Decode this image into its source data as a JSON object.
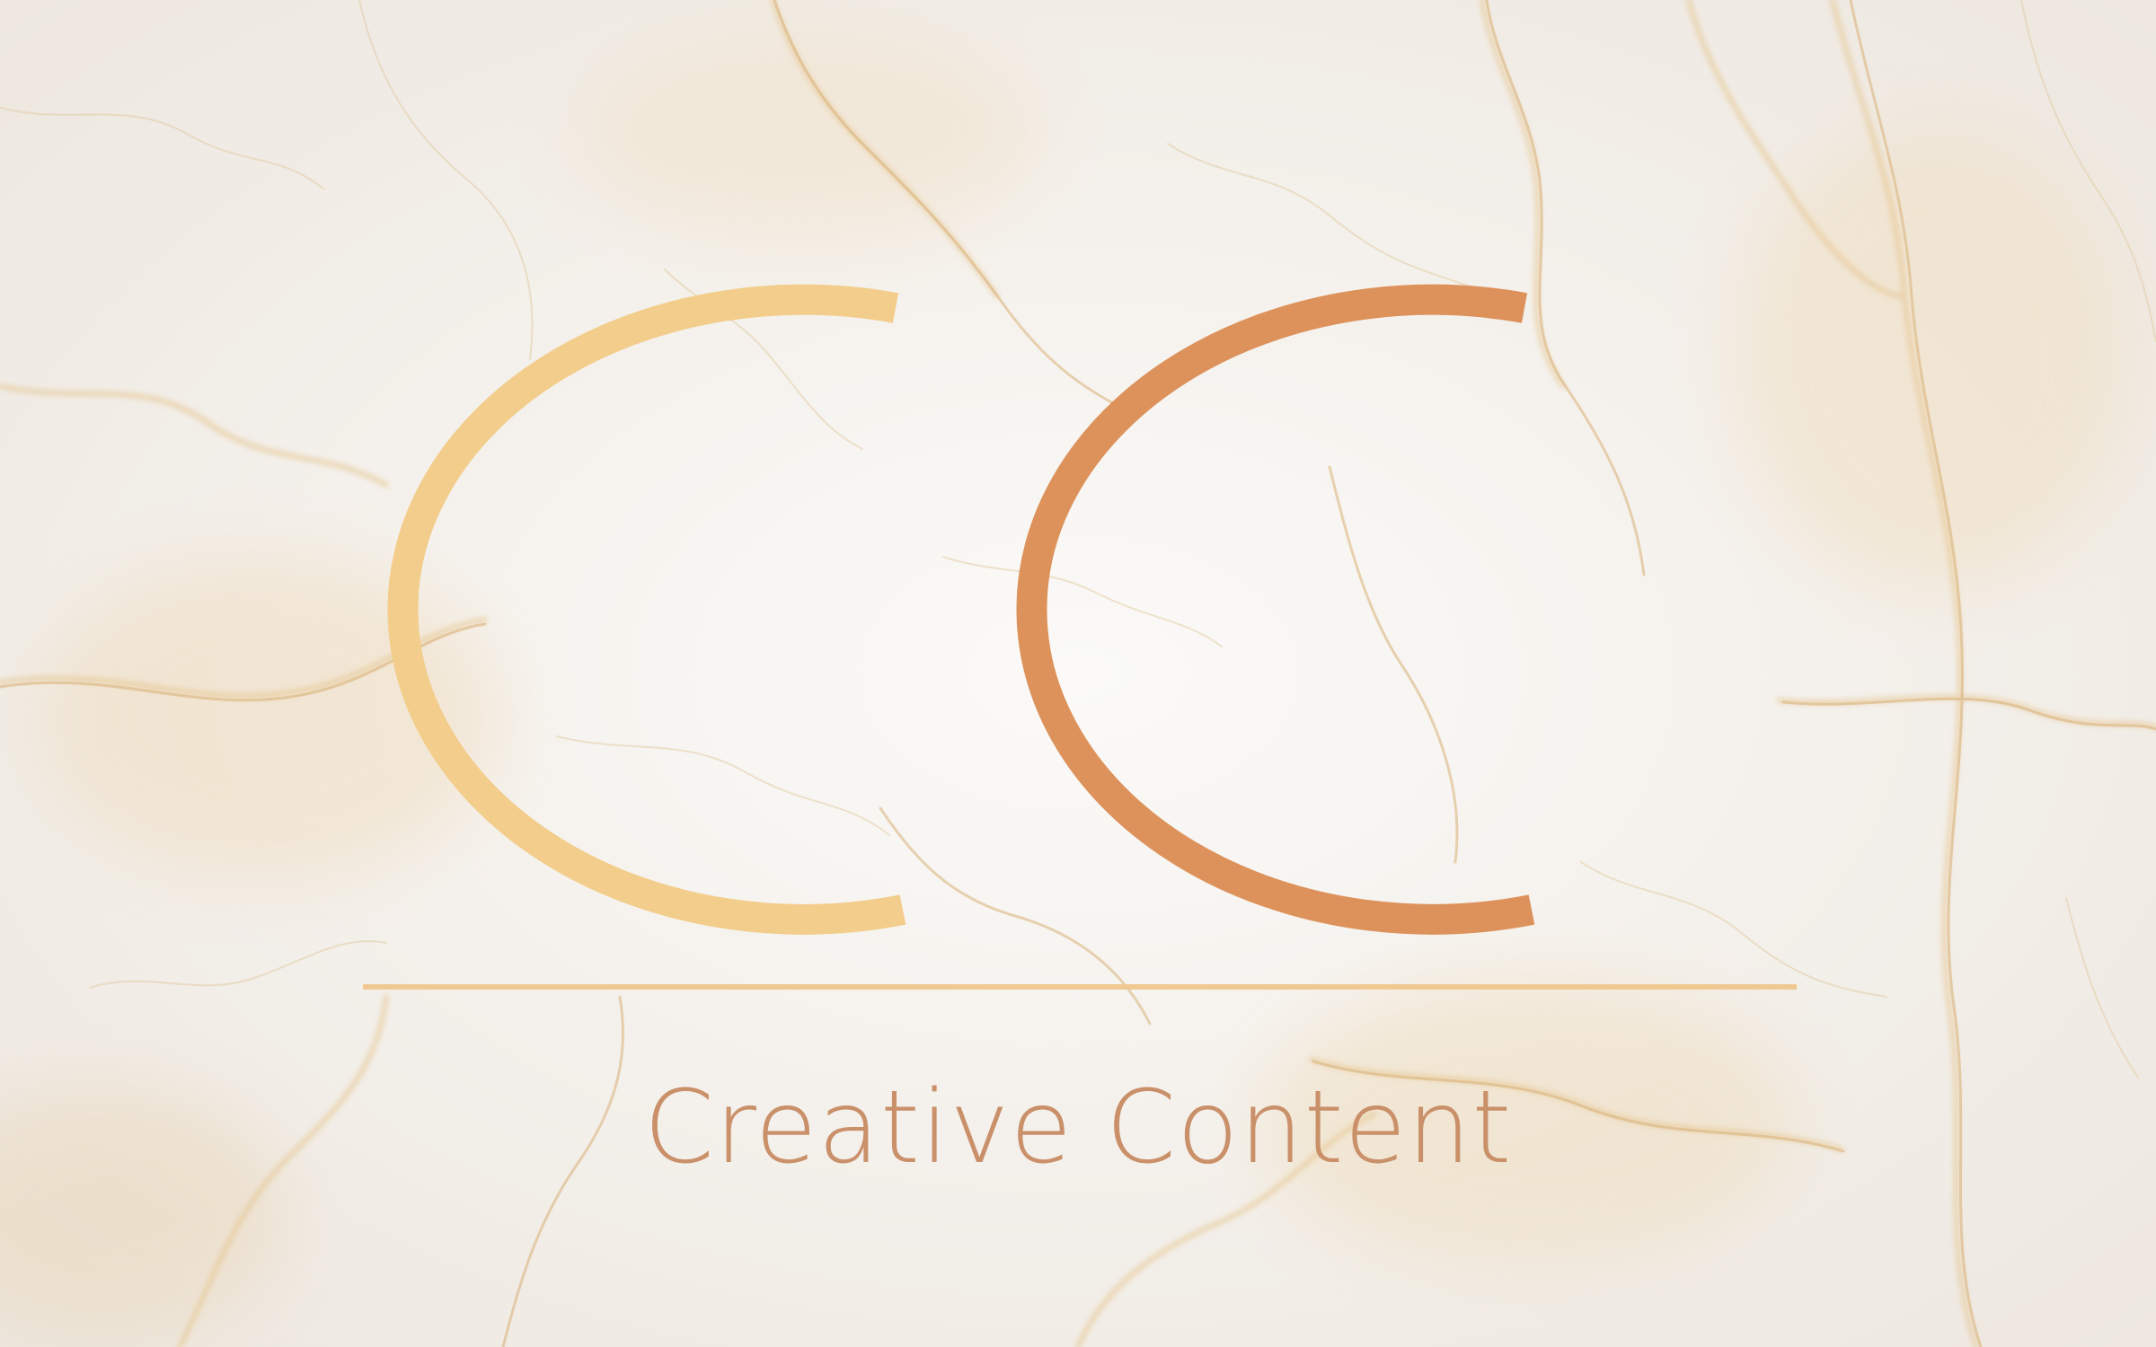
{
  "logo": {
    "monogram_letters": "CC",
    "tagline": "Creative Content"
  },
  "colors": {
    "background": "#f2efec",
    "marble_vein": "#e7c78c",
    "marble_vein_dark": "#d9a95c",
    "letter_left": "#f3cd8c",
    "letter_right": "#dd925b",
    "divider": "#f0c992",
    "tagline": "#c9906a"
  },
  "icons": {
    "left_letter": "letter-c-left-icon",
    "right_letter": "letter-c-right-icon"
  }
}
